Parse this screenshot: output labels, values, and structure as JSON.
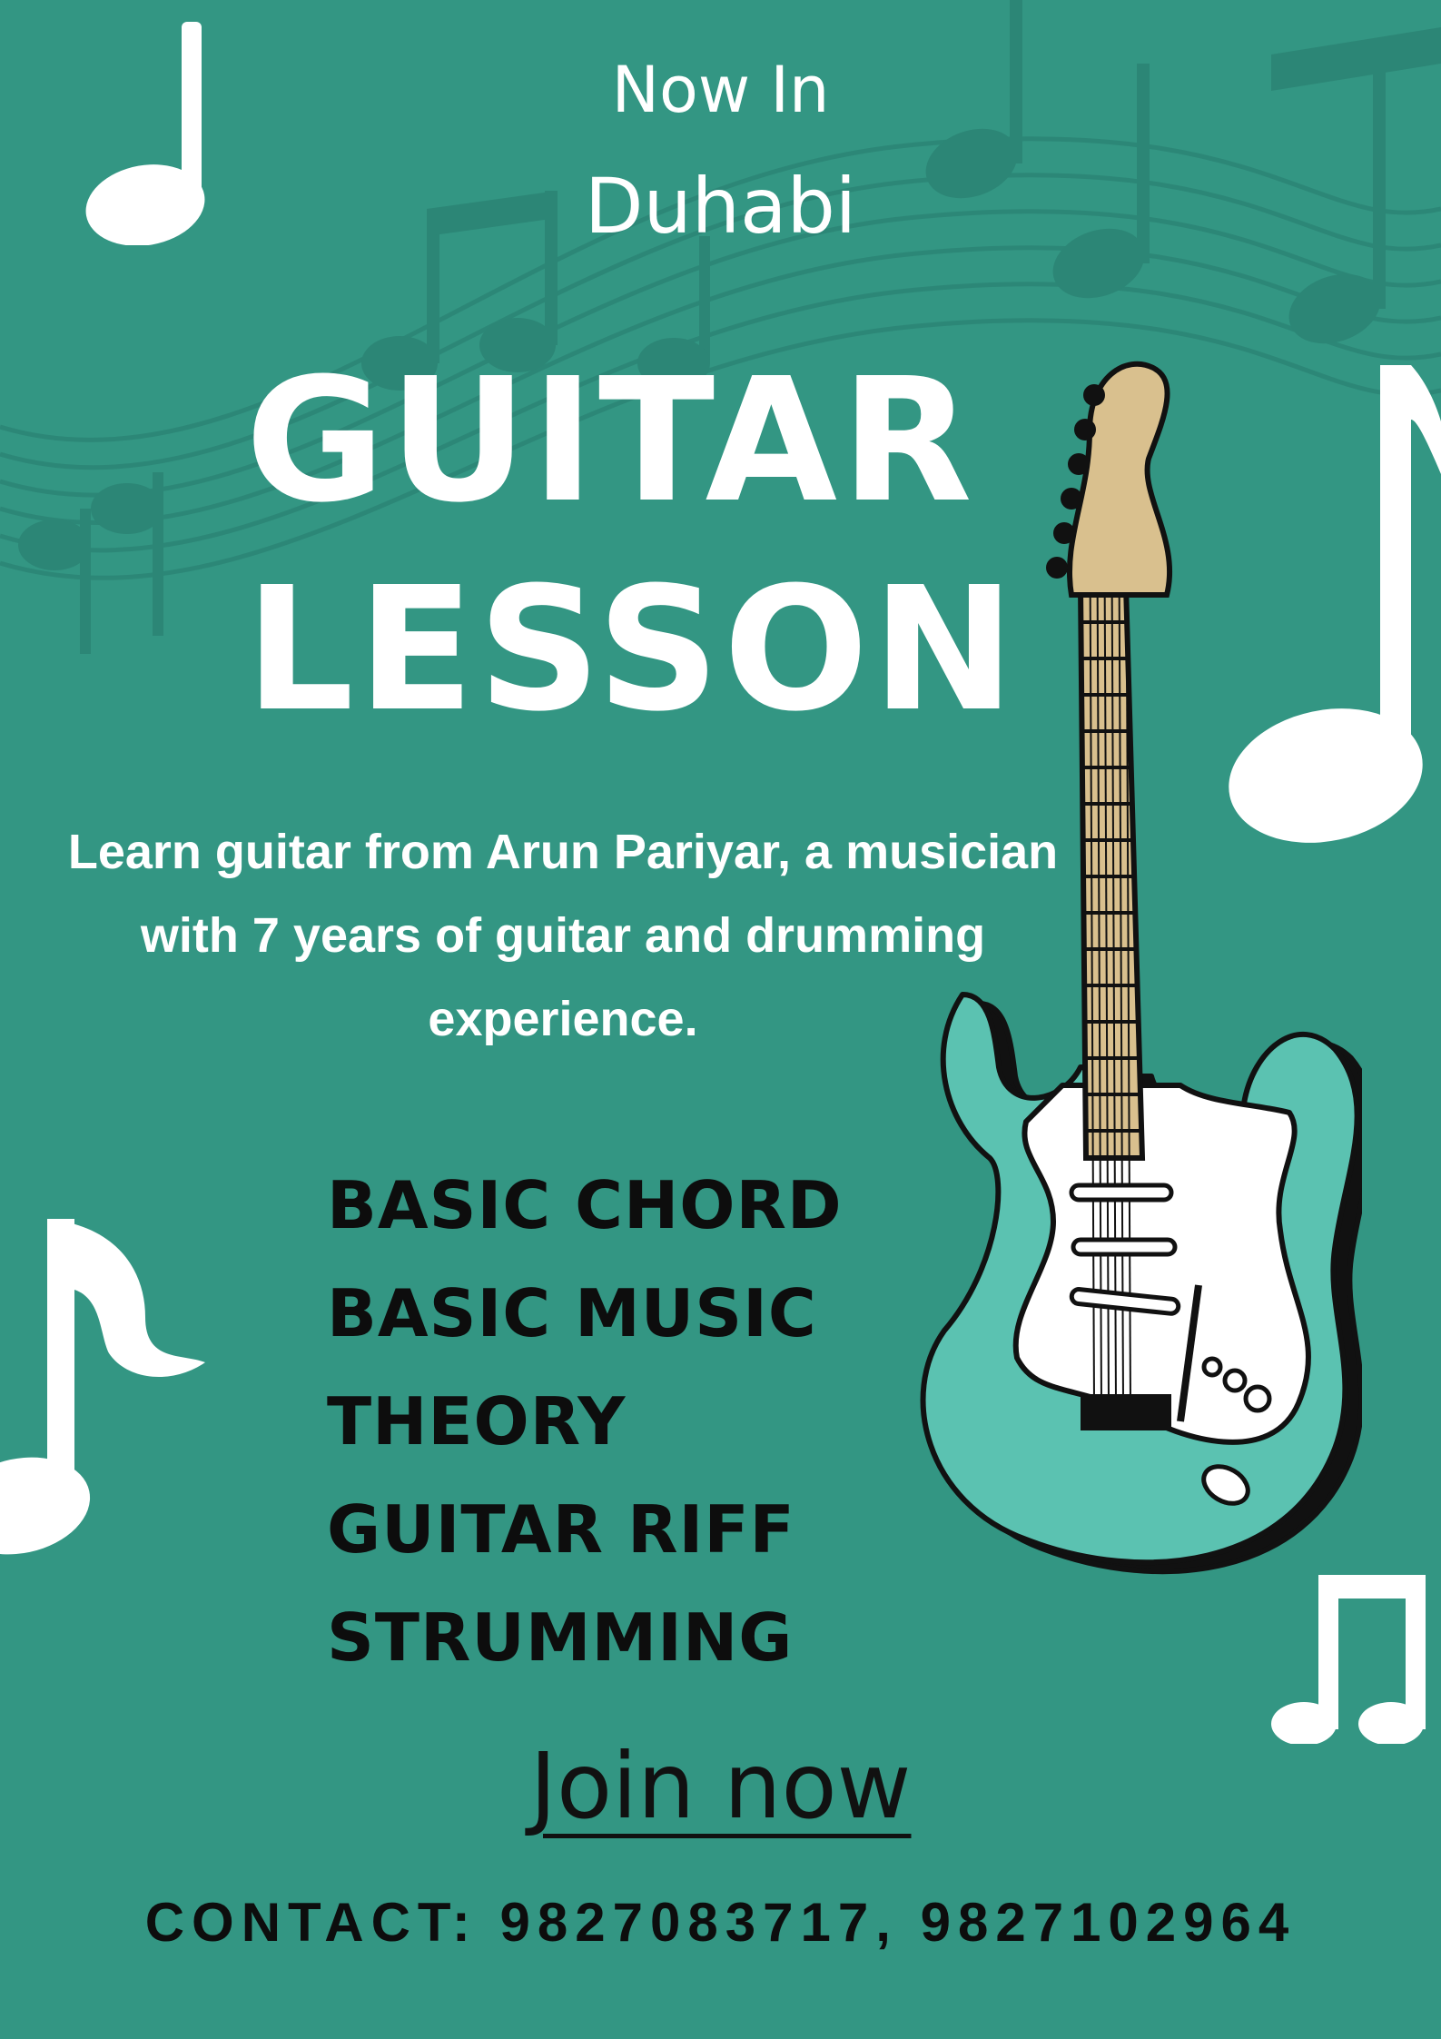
{
  "poster": {
    "kicker": "Now In",
    "city": "Duhabi",
    "title_line1": "GUITAR",
    "title_line2": "LESSON",
    "description": "Learn guitar from Arun Pariyar, a musician with 7 years of guitar and drumming experience.",
    "topics": [
      "BASIC CHORD",
      "BASIC MUSIC",
      "THEORY",
      "GUITAR RIFF",
      "STRUMMING"
    ],
    "cta": "Join now",
    "contact": "CONTACT: 9827083717, 9827102964"
  },
  "colors": {
    "background": "#339683",
    "text_light": "#ffffff",
    "text_dark": "#0d0d0d",
    "guitar_body": "#5bc2b1",
    "guitar_neck": "#d9c08e"
  },
  "icons": [
    "eighth-note-icon",
    "beamed-notes-icon",
    "quarter-note-icon",
    "music-staff-icon",
    "electric-guitar-icon"
  ]
}
